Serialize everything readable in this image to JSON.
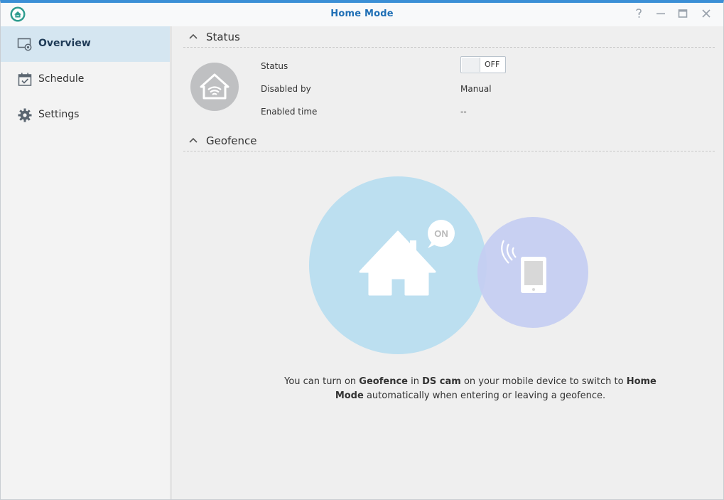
{
  "window": {
    "title": "Home Mode"
  },
  "sidebar": {
    "items": [
      {
        "label": "Overview",
        "icon": "overview-icon",
        "active": true
      },
      {
        "label": "Schedule",
        "icon": "calendar-icon",
        "active": false
      },
      {
        "label": "Settings",
        "icon": "gear-icon",
        "active": false
      }
    ]
  },
  "status_section": {
    "title": "Status",
    "rows": [
      {
        "label": "Status",
        "value": "OFF"
      },
      {
        "label": "Disabled by",
        "value": "Manual"
      },
      {
        "label": "Enabled time",
        "value": "--"
      }
    ]
  },
  "geofence_section": {
    "title": "Geofence",
    "badge": "ON",
    "text": {
      "p1": "You can turn on ",
      "b1": "Geofence",
      "p2": " in ",
      "b2": "DS cam",
      "p3": " on your mobile device to switch to ",
      "b3": "Home",
      "b4": "Mode",
      "p4": " automatically when entering or leaving a geofence."
    }
  },
  "colors": {
    "accent": "#1f6fb5",
    "titlebar_border": "#3b8fd6",
    "active_nav": "#d5e6f1",
    "home_circle": "#bcdff0",
    "device_circle": "#c8cdf3"
  }
}
